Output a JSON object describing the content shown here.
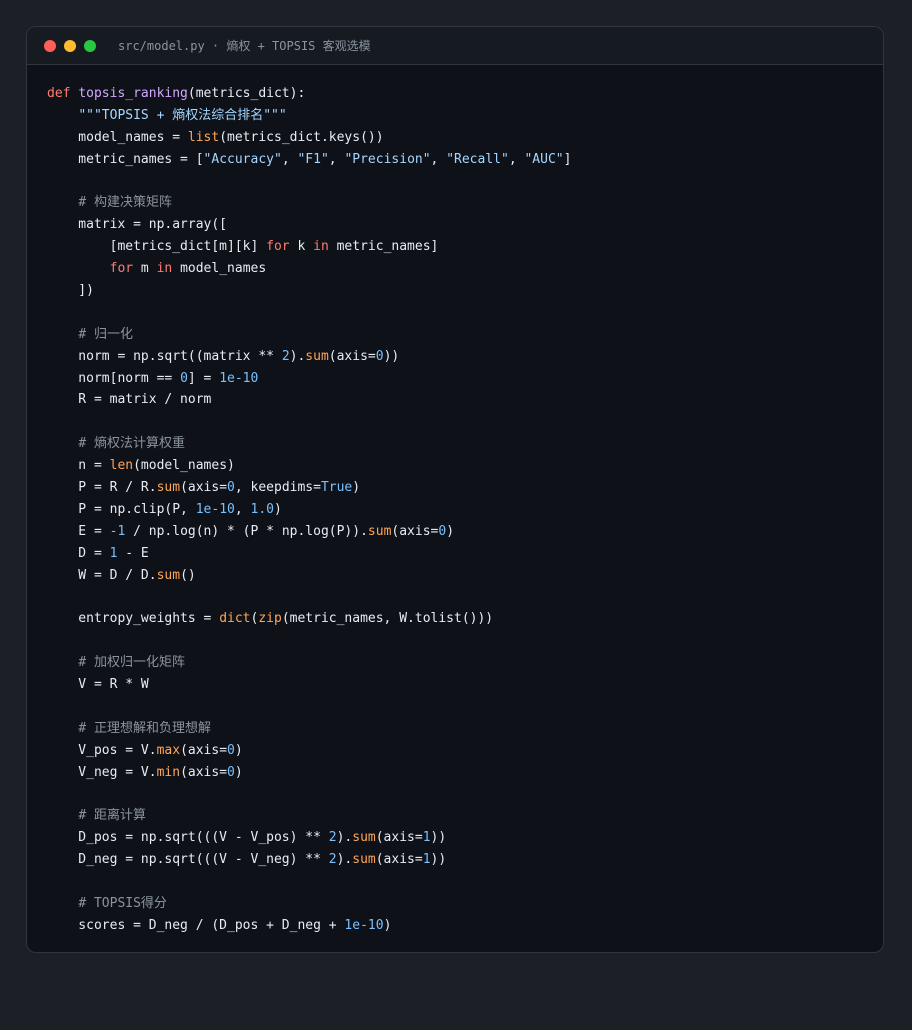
{
  "window": {
    "title": "src/model.py · 熵权 + TOPSIS 客观选模",
    "buttons": {
      "close": {
        "color": "#ff5f57"
      },
      "minimize": {
        "color": "#febc2e"
      },
      "maximize": {
        "color": "#28c840"
      }
    }
  },
  "colors": {
    "keyword": "#ff7b72",
    "function": "#d2a8ff",
    "builtin": "#ffa657",
    "string": "#a5d6ff",
    "number": "#79c0ff",
    "comment": "#8b949e",
    "plain": "#e6edf3"
  },
  "code": {
    "lines": [
      [
        {
          "t": "def",
          "k": "kw"
        },
        {
          "t": " ",
          "k": "p"
        },
        {
          "t": "topsis_ranking",
          "k": "fn"
        },
        {
          "t": "(metrics_dict):",
          "k": "p"
        }
      ],
      [
        {
          "t": "    ",
          "k": "p"
        },
        {
          "t": "\"\"\"TOPSIS + 熵权法综合排名\"\"\"",
          "k": "str"
        }
      ],
      [
        {
          "t": "    model_names = ",
          "k": "p"
        },
        {
          "t": "list",
          "k": "bi"
        },
        {
          "t": "(metrics_dict.keys())",
          "k": "p"
        }
      ],
      [
        {
          "t": "    metric_names = [",
          "k": "p"
        },
        {
          "t": "\"Accuracy\"",
          "k": "str"
        },
        {
          "t": ", ",
          "k": "p"
        },
        {
          "t": "\"F1\"",
          "k": "str"
        },
        {
          "t": ", ",
          "k": "p"
        },
        {
          "t": "\"Precision\"",
          "k": "str"
        },
        {
          "t": ", ",
          "k": "p"
        },
        {
          "t": "\"Recall\"",
          "k": "str"
        },
        {
          "t": ", ",
          "k": "p"
        },
        {
          "t": "\"AUC\"",
          "k": "str"
        },
        {
          "t": "]",
          "k": "p"
        }
      ],
      [],
      [
        {
          "t": "    ",
          "k": "p"
        },
        {
          "t": "# 构建决策矩阵",
          "k": "cm"
        }
      ],
      [
        {
          "t": "    matrix = np.array([",
          "k": "p"
        }
      ],
      [
        {
          "t": "        [metrics_dict[m][k] ",
          "k": "p"
        },
        {
          "t": "for",
          "k": "kw"
        },
        {
          "t": " k ",
          "k": "p"
        },
        {
          "t": "in",
          "k": "kw"
        },
        {
          "t": " metric_names]",
          "k": "p"
        }
      ],
      [
        {
          "t": "        ",
          "k": "p"
        },
        {
          "t": "for",
          "k": "kw"
        },
        {
          "t": " m ",
          "k": "p"
        },
        {
          "t": "in",
          "k": "kw"
        },
        {
          "t": " model_names",
          "k": "p"
        }
      ],
      [
        {
          "t": "    ])",
          "k": "p"
        }
      ],
      [],
      [
        {
          "t": "    ",
          "k": "p"
        },
        {
          "t": "# 归一化",
          "k": "cm"
        }
      ],
      [
        {
          "t": "    norm = np.sqrt((matrix ** ",
          "k": "p"
        },
        {
          "t": "2",
          "k": "num"
        },
        {
          "t": ").",
          "k": "p"
        },
        {
          "t": "sum",
          "k": "bi"
        },
        {
          "t": "(axis=",
          "k": "p"
        },
        {
          "t": "0",
          "k": "num"
        },
        {
          "t": "))",
          "k": "p"
        }
      ],
      [
        {
          "t": "    norm[norm == ",
          "k": "p"
        },
        {
          "t": "0",
          "k": "num"
        },
        {
          "t": "] = ",
          "k": "p"
        },
        {
          "t": "1e-10",
          "k": "num"
        }
      ],
      [
        {
          "t": "    R = matrix / norm",
          "k": "p"
        }
      ],
      [],
      [
        {
          "t": "    ",
          "k": "p"
        },
        {
          "t": "# 熵权法计算权重",
          "k": "cm"
        }
      ],
      [
        {
          "t": "    n = ",
          "k": "p"
        },
        {
          "t": "len",
          "k": "bi"
        },
        {
          "t": "(model_names)",
          "k": "p"
        }
      ],
      [
        {
          "t": "    P = R / R.",
          "k": "p"
        },
        {
          "t": "sum",
          "k": "bi"
        },
        {
          "t": "(axis=",
          "k": "p"
        },
        {
          "t": "0",
          "k": "num"
        },
        {
          "t": ", keepdims=",
          "k": "p"
        },
        {
          "t": "True",
          "k": "num"
        },
        {
          "t": ")",
          "k": "p"
        }
      ],
      [
        {
          "t": "    P = np.clip(P, ",
          "k": "p"
        },
        {
          "t": "1e-10",
          "k": "num"
        },
        {
          "t": ", ",
          "k": "p"
        },
        {
          "t": "1.0",
          "k": "num"
        },
        {
          "t": ")",
          "k": "p"
        }
      ],
      [
        {
          "t": "    E = ",
          "k": "p"
        },
        {
          "t": "-1",
          "k": "num"
        },
        {
          "t": " / np.log(n) * (P * np.log(P)).",
          "k": "p"
        },
        {
          "t": "sum",
          "k": "bi"
        },
        {
          "t": "(axis=",
          "k": "p"
        },
        {
          "t": "0",
          "k": "num"
        },
        {
          "t": ")",
          "k": "p"
        }
      ],
      [
        {
          "t": "    D = ",
          "k": "p"
        },
        {
          "t": "1",
          "k": "num"
        },
        {
          "t": " - E",
          "k": "p"
        }
      ],
      [
        {
          "t": "    W = D / D.",
          "k": "p"
        },
        {
          "t": "sum",
          "k": "bi"
        },
        {
          "t": "()",
          "k": "p"
        }
      ],
      [],
      [
        {
          "t": "    entropy_weights = ",
          "k": "p"
        },
        {
          "t": "dict",
          "k": "bi"
        },
        {
          "t": "(",
          "k": "p"
        },
        {
          "t": "zip",
          "k": "bi"
        },
        {
          "t": "(metric_names, W.tolist()))",
          "k": "p"
        }
      ],
      [],
      [
        {
          "t": "    ",
          "k": "p"
        },
        {
          "t": "# 加权归一化矩阵",
          "k": "cm"
        }
      ],
      [
        {
          "t": "    V = R * W",
          "k": "p"
        }
      ],
      [],
      [
        {
          "t": "    ",
          "k": "p"
        },
        {
          "t": "# 正理想解和负理想解",
          "k": "cm"
        }
      ],
      [
        {
          "t": "    V_pos = V.",
          "k": "p"
        },
        {
          "t": "max",
          "k": "bi"
        },
        {
          "t": "(axis=",
          "k": "p"
        },
        {
          "t": "0",
          "k": "num"
        },
        {
          "t": ")",
          "k": "p"
        }
      ],
      [
        {
          "t": "    V_neg = V.",
          "k": "p"
        },
        {
          "t": "min",
          "k": "bi"
        },
        {
          "t": "(axis=",
          "k": "p"
        },
        {
          "t": "0",
          "k": "num"
        },
        {
          "t": ")",
          "k": "p"
        }
      ],
      [],
      [
        {
          "t": "    ",
          "k": "p"
        },
        {
          "t": "# 距离计算",
          "k": "cm"
        }
      ],
      [
        {
          "t": "    D_pos = np.sqrt(((V - V_pos) ** ",
          "k": "p"
        },
        {
          "t": "2",
          "k": "num"
        },
        {
          "t": ").",
          "k": "p"
        },
        {
          "t": "sum",
          "k": "bi"
        },
        {
          "t": "(axis=",
          "k": "p"
        },
        {
          "t": "1",
          "k": "num"
        },
        {
          "t": "))",
          "k": "p"
        }
      ],
      [
        {
          "t": "    D_neg = np.sqrt(((V - V_neg) ** ",
          "k": "p"
        },
        {
          "t": "2",
          "k": "num"
        },
        {
          "t": ").",
          "k": "p"
        },
        {
          "t": "sum",
          "k": "bi"
        },
        {
          "t": "(axis=",
          "k": "p"
        },
        {
          "t": "1",
          "k": "num"
        },
        {
          "t": "))",
          "k": "p"
        }
      ],
      [],
      [
        {
          "t": "    ",
          "k": "p"
        },
        {
          "t": "# TOPSIS得分",
          "k": "cm"
        }
      ],
      [
        {
          "t": "    scores = D_neg / (D_pos + D_neg + ",
          "k": "p"
        },
        {
          "t": "1e-10",
          "k": "num"
        },
        {
          "t": ")",
          "k": "p"
        }
      ]
    ]
  }
}
